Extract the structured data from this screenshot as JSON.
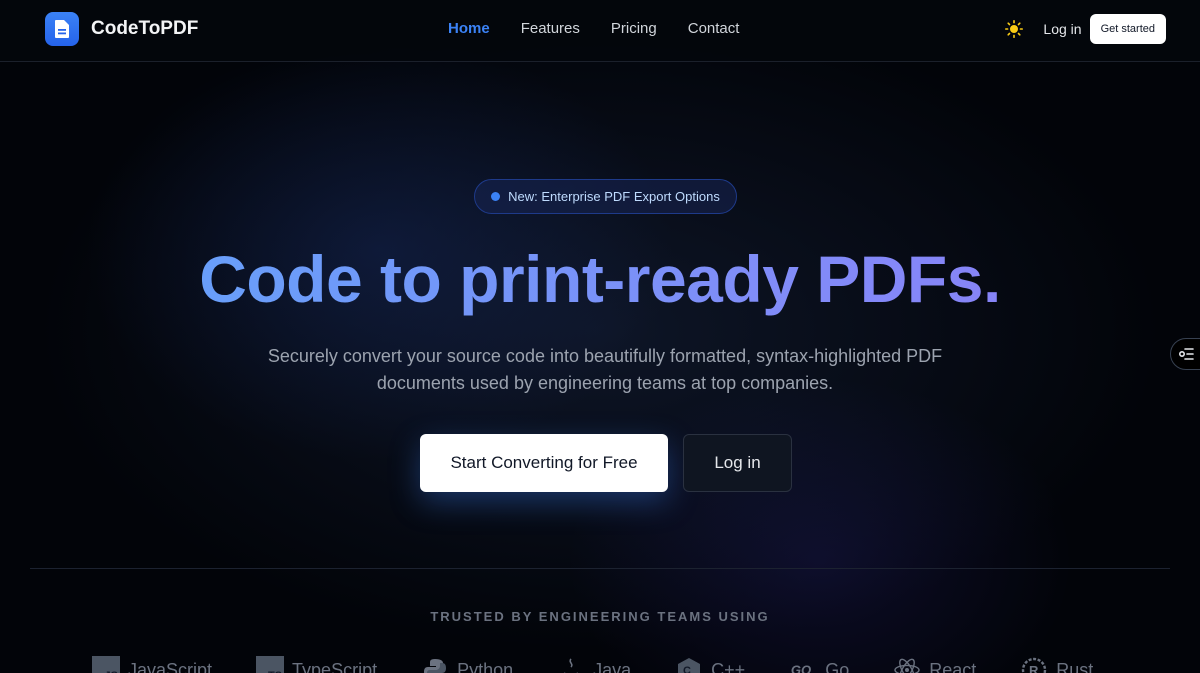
{
  "brand": {
    "name": "CodeToPDF"
  },
  "nav": {
    "links": [
      {
        "label": "Home",
        "active": true
      },
      {
        "label": "Features",
        "active": false
      },
      {
        "label": "Pricing",
        "active": false
      },
      {
        "label": "Contact",
        "active": false
      }
    ],
    "login_label": "Log in",
    "get_started_label": "Get started"
  },
  "hero": {
    "badge_text": "New: Enterprise PDF Export Options",
    "title": "Code to print-ready PDFs.",
    "subtitle": "Securely convert your source code into beautifully formatted, syntax-highlighted PDF documents used by engineering teams at top companies.",
    "primary_cta": "Start Converting for Free",
    "secondary_cta": "Log in"
  },
  "trusted": {
    "label": "TRUSTED BY ENGINEERING TEAMS USING",
    "logos": [
      {
        "name": "JavaScript",
        "icon": "javascript-icon",
        "icon_text": "JS"
      },
      {
        "name": "TypeScript",
        "icon": "typescript-icon",
        "icon_text": "TS"
      },
      {
        "name": "Python",
        "icon": "python-icon"
      },
      {
        "name": "Java",
        "icon": "java-icon"
      },
      {
        "name": "C++",
        "icon": "cpp-icon"
      },
      {
        "name": "Go",
        "icon": "go-icon"
      },
      {
        "name": "React",
        "icon": "react-icon"
      },
      {
        "name": "Rust",
        "icon": "rust-icon"
      }
    ]
  },
  "colors": {
    "accent": "#3b82f6",
    "gradient_start": "#60a5fa",
    "gradient_end": "#8b7cf6",
    "background": "#020409"
  }
}
